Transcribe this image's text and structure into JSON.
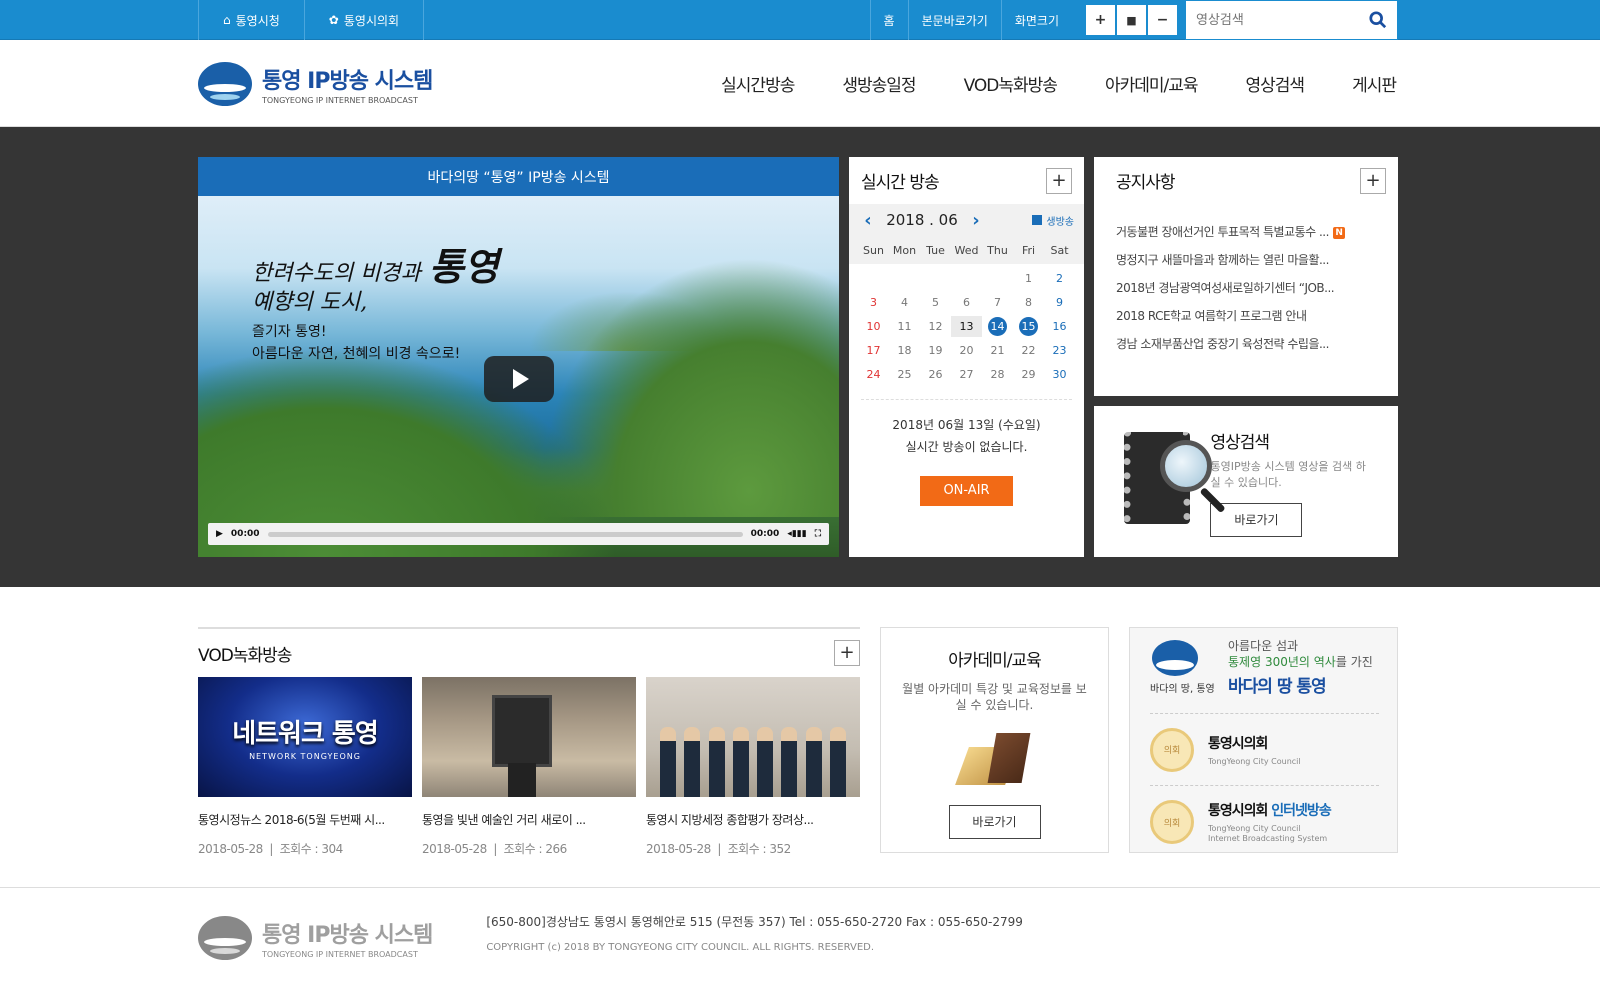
{
  "topbar": {
    "links": [
      "통영시청",
      "통영시의회"
    ],
    "home": "홈",
    "skip": "본문바로가기",
    "zoom_label": "화면크기",
    "zoom_in": "+",
    "zoom_reset": "■",
    "zoom_out": "−",
    "search_placeholder": "영상검색"
  },
  "header": {
    "logo_title": "통영 IP방송 시스템",
    "logo_sub": "TONGYEONG IP INTERNET BROADCAST",
    "nav": [
      "실시간방송",
      "생방송일정",
      "VOD녹화방송",
      "아카데미/교육",
      "영상검색",
      "게시판"
    ]
  },
  "player": {
    "title": "바다의땅 “통영” IP방송 시스템",
    "headline_1": "한려수도의 비경과",
    "headline_big": "통영",
    "headline_2": "예향의 도시,",
    "sub_1": "즐기자 통영!",
    "sub_2": "아름다운 자연, 천혜의 비경 속으로!",
    "time_current": "00:00",
    "time_total": "00:00"
  },
  "live": {
    "title": "실시간 방송",
    "month": "2018 . 06",
    "legend": "생방송",
    "weekdays": [
      "Sun",
      "Mon",
      "Tue",
      "Wed",
      "Thu",
      "Fri",
      "Sat"
    ],
    "date_text": "2018년 06월 13일 (수요일)",
    "status_text": "실시간 방송이 없습니다.",
    "onair_label": "ON-AIR"
  },
  "notice": {
    "title": "공지사항",
    "new_badge": "N",
    "items": [
      "거동불편 장애선거인 투표목적 특별교통수 ...",
      "명정지구 새뜰마을과 함께하는 열린 마을활...",
      "2018년 경남광역여성새로일하기센터 “JOB...",
      "2018 RCE학교 여름학기 프로그램 안내",
      "경남 소재부품산업 중장기 육성전략 수립을..."
    ]
  },
  "video_search": {
    "title": "영상검색",
    "desc": "통영IP방송 시스템 영상을 검색 하실 수 있습니다.",
    "button": "바로가기"
  },
  "vod": {
    "title": "VOD녹화방송",
    "items": [
      {
        "title": "통영시정뉴스 2018-6(5월 두번째 시...",
        "date": "2018-05-28",
        "views": "조회수 : 304",
        "thumb_big": "네트워크 통영",
        "thumb_small": "NETWORK TONGYEONG"
      },
      {
        "title": "통영을 빛낸 예술인 거리 새로이 ...",
        "date": "2018-05-28",
        "views": "조회수 : 266"
      },
      {
        "title": "통영시 지방세정 종합평가 장려상...",
        "date": "2018-05-28",
        "views": "조회수 : 352"
      }
    ]
  },
  "academy": {
    "title": "아카데미/교육",
    "desc": "월별 아카데미 특강 및 교육정보를 보실 수 있습니다.",
    "button": "바로가기"
  },
  "links": {
    "tag_line1": "아름다운 섬과",
    "tag_line2_green": "통제영 300년의 역사",
    "tag_line2_rest": "를 가진",
    "tag_title": "바다의 땅 통영",
    "emblem_label": "바다의 땅, 통영",
    "council": {
      "title": "통영시의회",
      "en": "TongYeong City Council",
      "seal": "의회"
    },
    "council_tv": {
      "title": "통영시의회",
      "title_em": "인터넷방송",
      "en1": "TongYeong City Council",
      "en2": "Internet Broadcasting System",
      "seal": "의회"
    }
  },
  "footer": {
    "logo_title": "통영 IP방송 시스템",
    "logo_sub": "TONGYEONG IP INTERNET BROADCAST",
    "address": "[650-800]경상남도 통영시 통영해안로 515 (무전동 357) Tel : 055-650-2720 Fax : 055-650-2799",
    "copyright": "COPYRIGHT (c) 2018 BY TONGYEONG CITY COUNCIL. ALL RIGHTS. RESERVED."
  },
  "colors": {
    "primary": "#1a8ccf",
    "brand": "#1a4fa0",
    "onair": "#f26a16",
    "dark_band": "#353535"
  }
}
